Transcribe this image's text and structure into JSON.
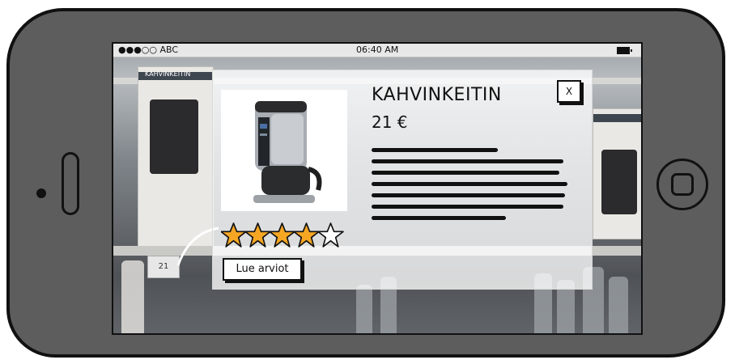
{
  "status_bar": {
    "carrier": "●●●○○ ABC",
    "time": "06:40 AM"
  },
  "product": {
    "name": "KAHVINKEITIN",
    "price": "21 €",
    "rating": 4,
    "max_rating": 5,
    "reviews_label": "Lue arviot",
    "close_label": "X"
  },
  "background": {
    "shelf_label": "KAHVINKEITIN",
    "price_tag": "21"
  },
  "colors": {
    "star_fill": "#f5a623",
    "star_outline": "#111111",
    "phone_body": "#5d5d5d"
  }
}
